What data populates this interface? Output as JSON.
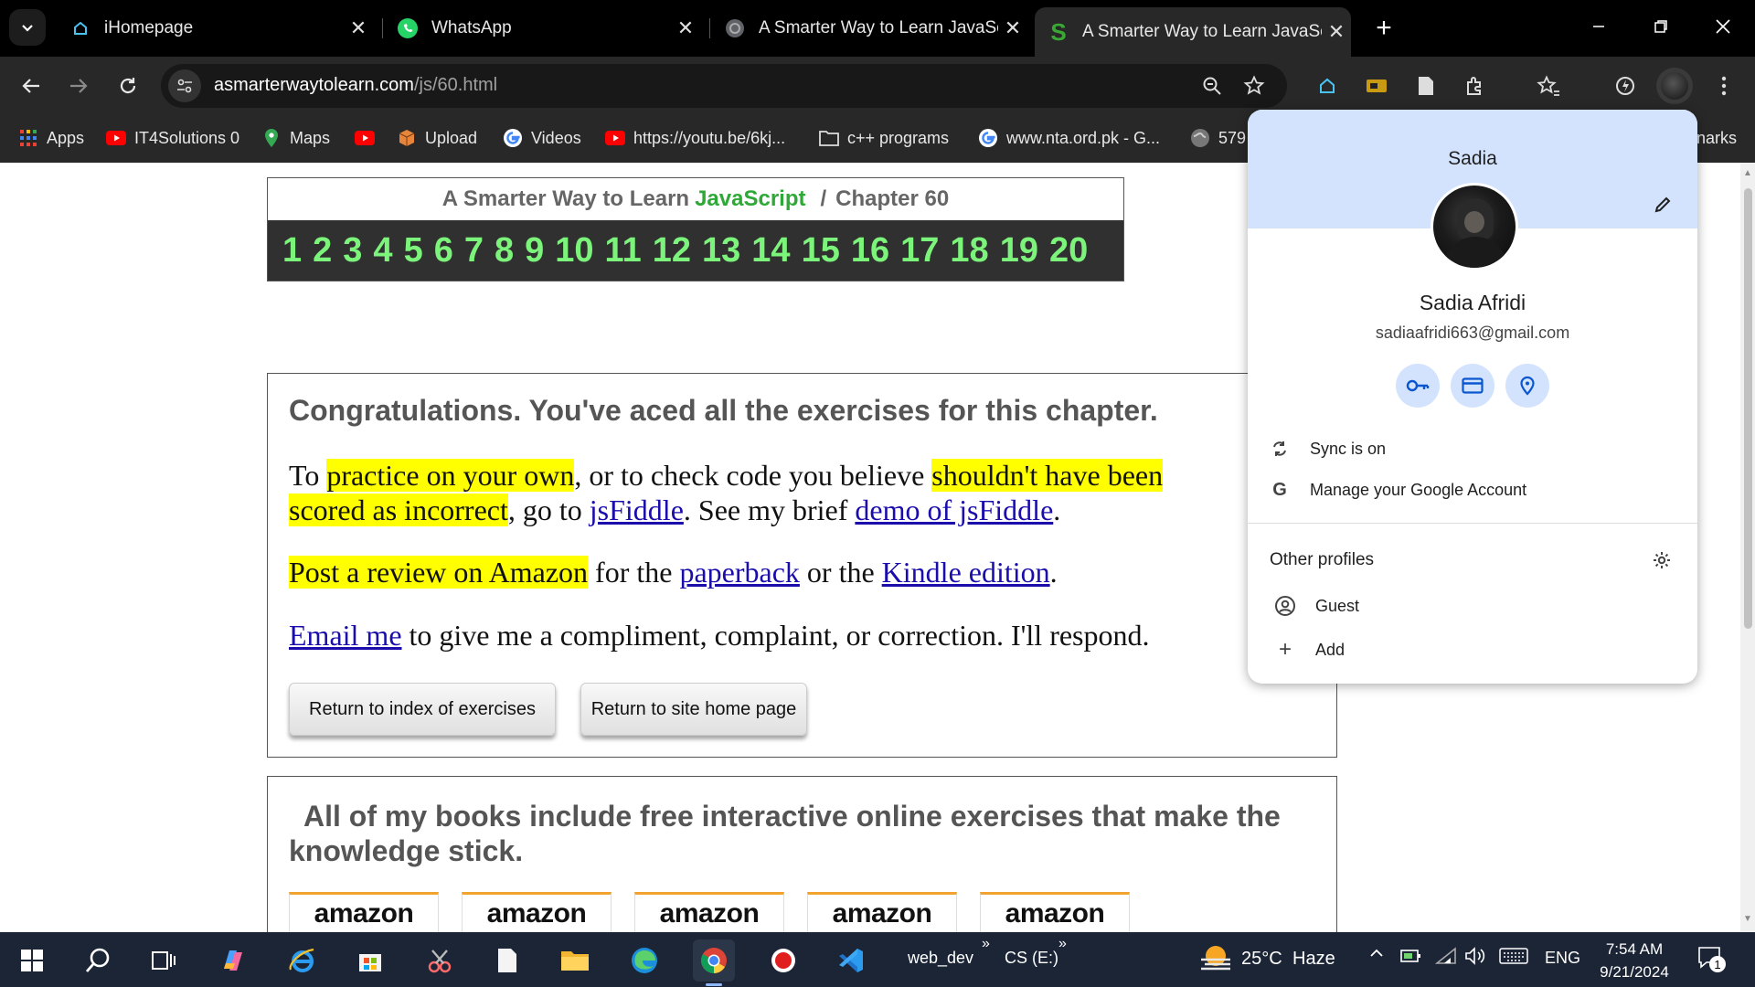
{
  "tabs": [
    {
      "title": "iHomepage"
    },
    {
      "title": "WhatsApp"
    },
    {
      "title": "A Smarter Way to Learn JavaScr"
    },
    {
      "title": "A Smarter Way to Learn JavaScr"
    }
  ],
  "address_bar": {
    "domain": "asmarterwaytolearn.com",
    "path": "/js/60.html"
  },
  "bookmarks": [
    {
      "label": "Apps"
    },
    {
      "label": "IT4Solutions 0"
    },
    {
      "label": "Maps"
    },
    {
      "label": "Upload"
    },
    {
      "label": "Videos"
    },
    {
      "label": "https://youtu.be/6kj..."
    },
    {
      "label": "c++ programs"
    },
    {
      "label": "www.nta.ord.pk - G..."
    },
    {
      "label": "579"
    },
    {
      "label": "narks"
    }
  ],
  "page": {
    "header": {
      "prefix": "A Smarter Way to Learn",
      "js": "JavaScript",
      "sep": "/",
      "chapter": "Chapter 60"
    },
    "chapters": [
      "1",
      "2",
      "3",
      "4",
      "5",
      "6",
      "7",
      "8",
      "9",
      "10",
      "11",
      "12",
      "13",
      "14",
      "15",
      "16",
      "17",
      "18",
      "19",
      "20"
    ],
    "congrats": {
      "title": "Congratulations. You've aced all the exercises for this chapter.",
      "p1_a": "To ",
      "p1_hl1": "practice on your own",
      "p1_b": ", or to check code you believe ",
      "p1_hl2": "shouldn't have been",
      "p1_hl3": "scored as incorrect",
      "p1_c": ", go to ",
      "p1_link1": "jsFiddle",
      "p1_d": ". See my brief ",
      "p1_link2": "demo of jsFiddle",
      "p1_e": ".",
      "p2_hl": "Post a review on Amazon",
      "p2_a": " for the ",
      "p2_link1": "paperback",
      "p2_b": " or the ",
      "p2_link2": "Kindle edition",
      "p2_c": ".",
      "p3_link": "Email me",
      "p3_a": " to give me a compliment, complaint, or correction. I'll respond.",
      "btn_index": "Return to index of exercises",
      "btn_home": "Return to site home page"
    },
    "books": {
      "title": "All of my books include free interactive online exercises that make the knowledge stick.",
      "amazon_labels": [
        "amazon",
        "amazon",
        "amazon",
        "amazon",
        "amazon"
      ]
    }
  },
  "profile_popup": {
    "name_top": "Sadia",
    "full_name": "Sadia Afridi",
    "email": "sadiaafridi663@gmail.com",
    "sync": "Sync is on",
    "manage": "Manage your Google Account",
    "other_profiles": "Other profiles",
    "guest": "Guest",
    "add": "Add"
  },
  "taskbar": {
    "folder_label": "web_dev",
    "drive_label": "CS (E:)",
    "weather_temp": "25°C",
    "weather_desc": "Haze",
    "lang": "ENG",
    "time": "7:54 AM",
    "date": "9/21/2024",
    "notif_count": "1"
  },
  "colors": {
    "accent_green": "#7cf37a",
    "highlight": "#ffff00",
    "link": "#1a0dab",
    "popup_header": "#d3e3fd"
  }
}
